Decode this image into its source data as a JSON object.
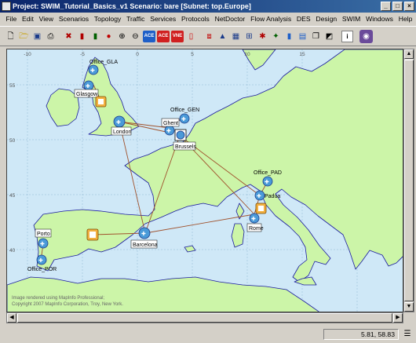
{
  "window": {
    "title": "Project: SWIM_Tutorial_Basics_v1 Scenario: bare  [Subnet: top.Europe]"
  },
  "menu": [
    "File",
    "Edit",
    "View",
    "Scenarios",
    "Topology",
    "Traffic",
    "Services",
    "Protocols",
    "NetDoctor",
    "Flow Analysis",
    "DES",
    "Design",
    "SWIM",
    "Windows",
    "Help"
  ],
  "toolbar": {
    "ace_label": "ACE",
    "ace_plus_label": "ACE",
    "vne_label": "VNE"
  },
  "map": {
    "lon_ticks": [
      "-10",
      "-5",
      "0",
      "5",
      "10",
      "15"
    ],
    "lat_ticks": [
      "55",
      "50",
      "45",
      "40"
    ],
    "nodes": {
      "office_gla": "Office_GLA",
      "glasgow": "Glasgow",
      "london": "London",
      "office_gen": "Office_GEN",
      "ghent": "Ghent",
      "brussels": "Brussels",
      "office_pad": "Office_PAD",
      "padua": "Padua",
      "rome": "Rome",
      "porto": "Porto",
      "office_por": "Office_POR",
      "barcelona": "Barcelona"
    },
    "copyright_line1": "Image rendered using MapInfo Professional;",
    "copyright_line2": "Copyright 2007 MapInfo Corporation, Troy, New York."
  },
  "status": {
    "coords": "5.81, 58.83"
  },
  "colors": {
    "sea": "#cfe8f7",
    "land": "#ccf5a8",
    "coast": "#1a1aa0",
    "link": "#a0522d",
    "title_bar": "#0a246a"
  }
}
